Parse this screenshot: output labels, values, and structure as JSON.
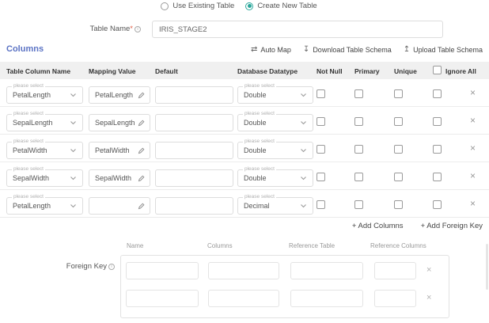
{
  "colors": {
    "accent": "#2aa79b",
    "heading": "#5b73c4",
    "required": "#e0614a"
  },
  "icons": {
    "info": "i",
    "swap": "⇄",
    "download": "↧",
    "upload": "↥",
    "close": "×"
  },
  "table_type": {
    "options": [
      {
        "label": "Use Existing Table",
        "selected": false
      },
      {
        "label": "Create New Table",
        "selected": true
      }
    ]
  },
  "table_name": {
    "label": "Table Name",
    "required_mark": "*",
    "value": "IRIS_STAGE2"
  },
  "columns_section": {
    "title": "Columns",
    "toolbar": {
      "auto_map": "Auto Map",
      "download": "Download Table Schema",
      "upload": "Upload Table Schema"
    },
    "headers": {
      "column": "Table Column Name",
      "mapping": "Mapping Value",
      "default": "Default",
      "datatype": "Database Datatype",
      "not_null": "Not Null",
      "primary": "Primary",
      "unique": "Unique",
      "ignore_all": "Ignore All"
    },
    "select_placeholder": "please select",
    "rows": [
      {
        "column": "PetalLength",
        "mapping": "PetalLength",
        "default": "",
        "datatype": "Double",
        "not_null": false,
        "primary": false,
        "unique": false,
        "ignore": false
      },
      {
        "column": "SepalLength",
        "mapping": "SepalLength",
        "default": "",
        "datatype": "Double",
        "not_null": false,
        "primary": false,
        "unique": false,
        "ignore": false
      },
      {
        "column": "PetalWidth",
        "mapping": "PetalWidth",
        "default": "",
        "datatype": "Double",
        "not_null": false,
        "primary": false,
        "unique": false,
        "ignore": false
      },
      {
        "column": "SepalWidth",
        "mapping": "SepalWidth",
        "default": "",
        "datatype": "Double",
        "not_null": false,
        "primary": false,
        "unique": false,
        "ignore": false
      },
      {
        "column": "PetalLength",
        "mapping": "",
        "default": "",
        "datatype": "Decimal",
        "not_null": false,
        "primary": false,
        "unique": false,
        "ignore": false
      }
    ],
    "add_columns": "+ Add Columns",
    "add_foreign_key": "+ Add Foreign Key"
  },
  "foreign_key": {
    "label": "Foreign Key",
    "headers": {
      "name": "Name",
      "columns": "Columns",
      "reference_table": "Reference Table",
      "reference_columns": "Reference Columns"
    },
    "row_count": 2
  }
}
